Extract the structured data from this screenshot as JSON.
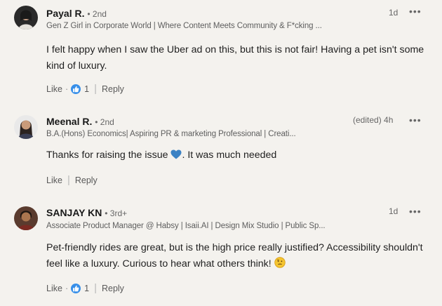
{
  "comments": [
    {
      "name": "Payal R.",
      "degree": "• 2nd",
      "headline": "Gen Z Girl in Corporate World | Where Content Meets Community & F*cking ...",
      "time": "1d",
      "more_icon": "ellipsis-icon",
      "body": "I felt happy when I saw the Uber ad on this, but this is not fair! Having a pet isn't some kind of luxury.",
      "like_label": "Like",
      "reaction_count": "1",
      "reply_label": "Reply"
    },
    {
      "name": "Meenal R.",
      "degree": "• 2nd",
      "headline": "B.A.(Hons) Economics| Aspiring PR & marketing Professional | Creati...",
      "time": "(edited) 4h",
      "more_icon": "ellipsis-icon",
      "body_before": "Thanks for raising the issue ",
      "body_after": ". It was much needed",
      "like_label": "Like",
      "reply_label": "Reply"
    },
    {
      "name": "SANJAY KN",
      "degree": "• 3rd+",
      "headline": "Associate Product Manager @ Habsy | Isaii.AI | Design Mix Studio | Public Sp...",
      "time": "1d",
      "more_icon": "ellipsis-icon",
      "body": "Pet-friendly rides are great, but is the high price really justified? Accessibility shouldn't feel like a luxury. Curious to hear what others think!",
      "like_label": "Like",
      "reaction_count": "1",
      "reply_label": "Reply"
    }
  ],
  "colors": {
    "reaction_blue": "#378fe9",
    "heart_blue": "#3b82c4",
    "page_bg": "#f4f2ee"
  },
  "icons": [
    "ellipsis-icon",
    "like-reaction-icon",
    "blue-heart-emoji-icon",
    "thinking-face-emoji-icon"
  ]
}
